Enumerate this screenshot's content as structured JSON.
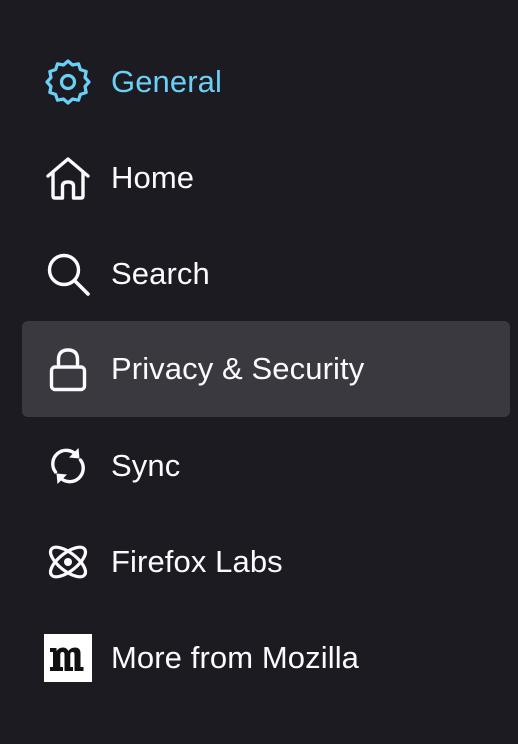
{
  "sidebar": {
    "items": [
      {
        "label": "General",
        "icon": "gear-icon",
        "active": true
      },
      {
        "label": "Home",
        "icon": "home-icon"
      },
      {
        "label": "Search",
        "icon": "search-icon"
      },
      {
        "label": "Privacy & Security",
        "icon": "lock-icon",
        "hovered": true
      },
      {
        "label": "Sync",
        "icon": "sync-icon"
      },
      {
        "label": "Firefox Labs",
        "icon": "atom-icon"
      },
      {
        "label": "More from Mozilla",
        "icon": "mozilla-logo-icon"
      }
    ]
  },
  "colors": {
    "background": "#1c1b22",
    "text": "#fbfbfe",
    "active": "#6bd0f6",
    "hover_background": "#3a393f"
  }
}
